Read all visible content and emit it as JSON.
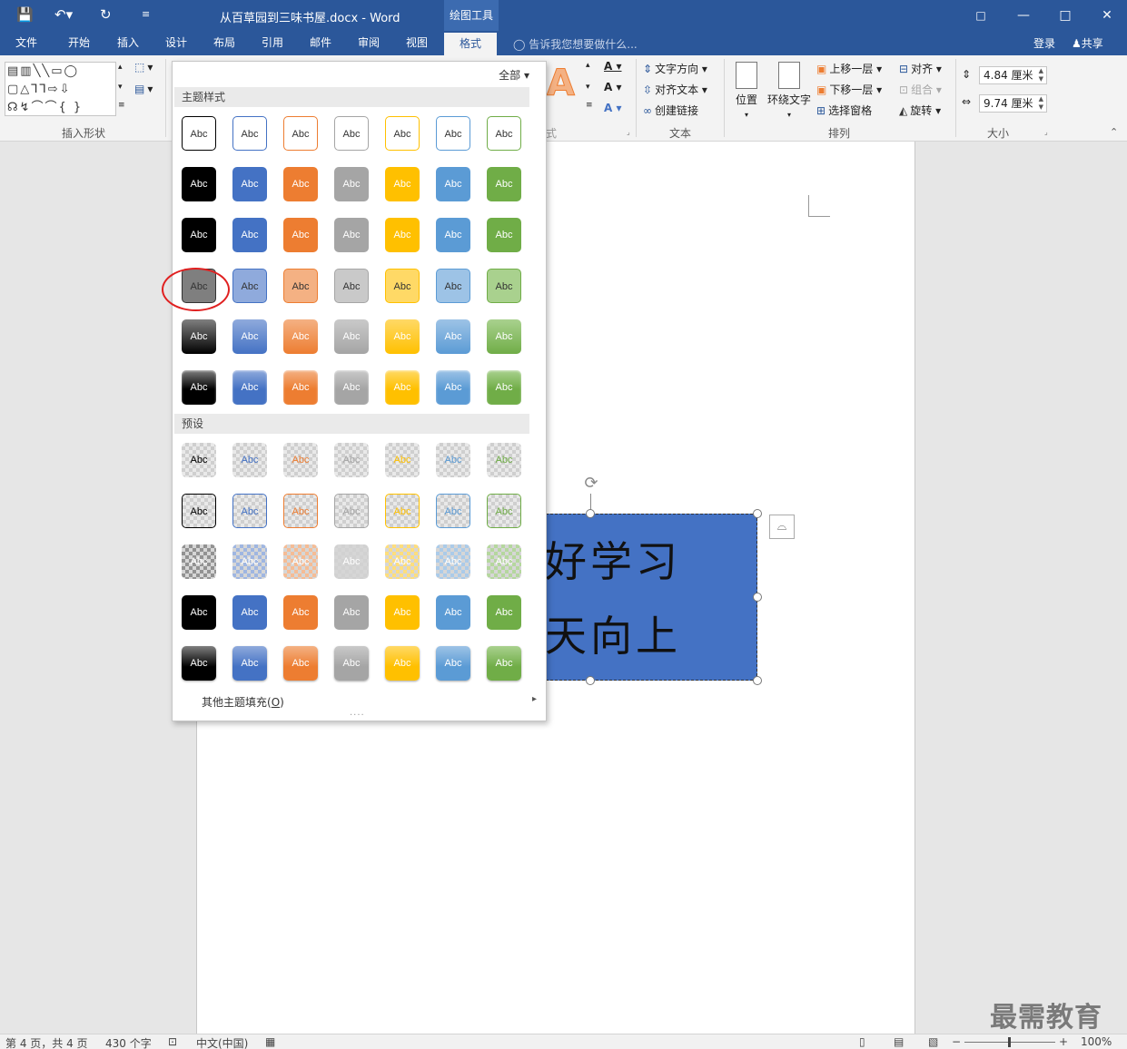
{
  "title_bar": {
    "doc_title": "从百草园到三味书屋.docx - Word",
    "context_tab": "绘图工具",
    "qat": {
      "save_icon": "save-icon",
      "undo_icon": "undo-icon",
      "redo_icon": "redo-icon",
      "customize_icon": "customize-qat-icon"
    }
  },
  "tabs": [
    {
      "label": "文件"
    },
    {
      "label": "开始"
    },
    {
      "label": "插入"
    },
    {
      "label": "设计"
    },
    {
      "label": "布局"
    },
    {
      "label": "引用"
    },
    {
      "label": "邮件"
    },
    {
      "label": "审阅"
    },
    {
      "label": "视图"
    },
    {
      "label": "格式",
      "active": true
    }
  ],
  "tell_me": "告诉我您想要做什么...",
  "login": "登录",
  "share": "共享",
  "ribbon": {
    "insert_shapes_label": "插入形状",
    "text_group_label": "文本",
    "text_direction": "文字方向",
    "align_text": "对齐文本",
    "create_link": "创建链接",
    "arrange_label": "排列",
    "position": "位置",
    "wrap_text": "环绕文字",
    "bring_forward": "上移一层",
    "send_backward": "下移一层",
    "selection_pane": "选择窗格",
    "align": "对齐",
    "group": "组合",
    "rotate": "旋转",
    "size_label": "大小",
    "height": "4.84 厘米",
    "width": "9.74 厘米",
    "partial_label": "式",
    "big_a": "A"
  },
  "gallery": {
    "filter": "全部",
    "theme_header": "主题样式",
    "preset_header": "预设",
    "swatch_text": "Abc",
    "more_fill_prefix": "其他主题填充(",
    "more_fill_key": "O",
    "more_fill_suffix": ")",
    "colors": [
      "#000000",
      "#4472c4",
      "#ed7d31",
      "#a5a5a5",
      "#ffc000",
      "#5b9bd5",
      "#70ad47"
    ],
    "light_colors": [
      "#7f7f7f",
      "#8faadc",
      "#f4b183",
      "#c9c9c9",
      "#ffd966",
      "#9dc3e6",
      "#a9d18e"
    ]
  },
  "textbox": {
    "line1": "好学习",
    "line2": "天向上"
  },
  "status": {
    "page": "第 4 页，共 4 页",
    "words": "430 个字",
    "lang": "中文(中国)",
    "zoom": "100%"
  },
  "watermark": "最需教育"
}
